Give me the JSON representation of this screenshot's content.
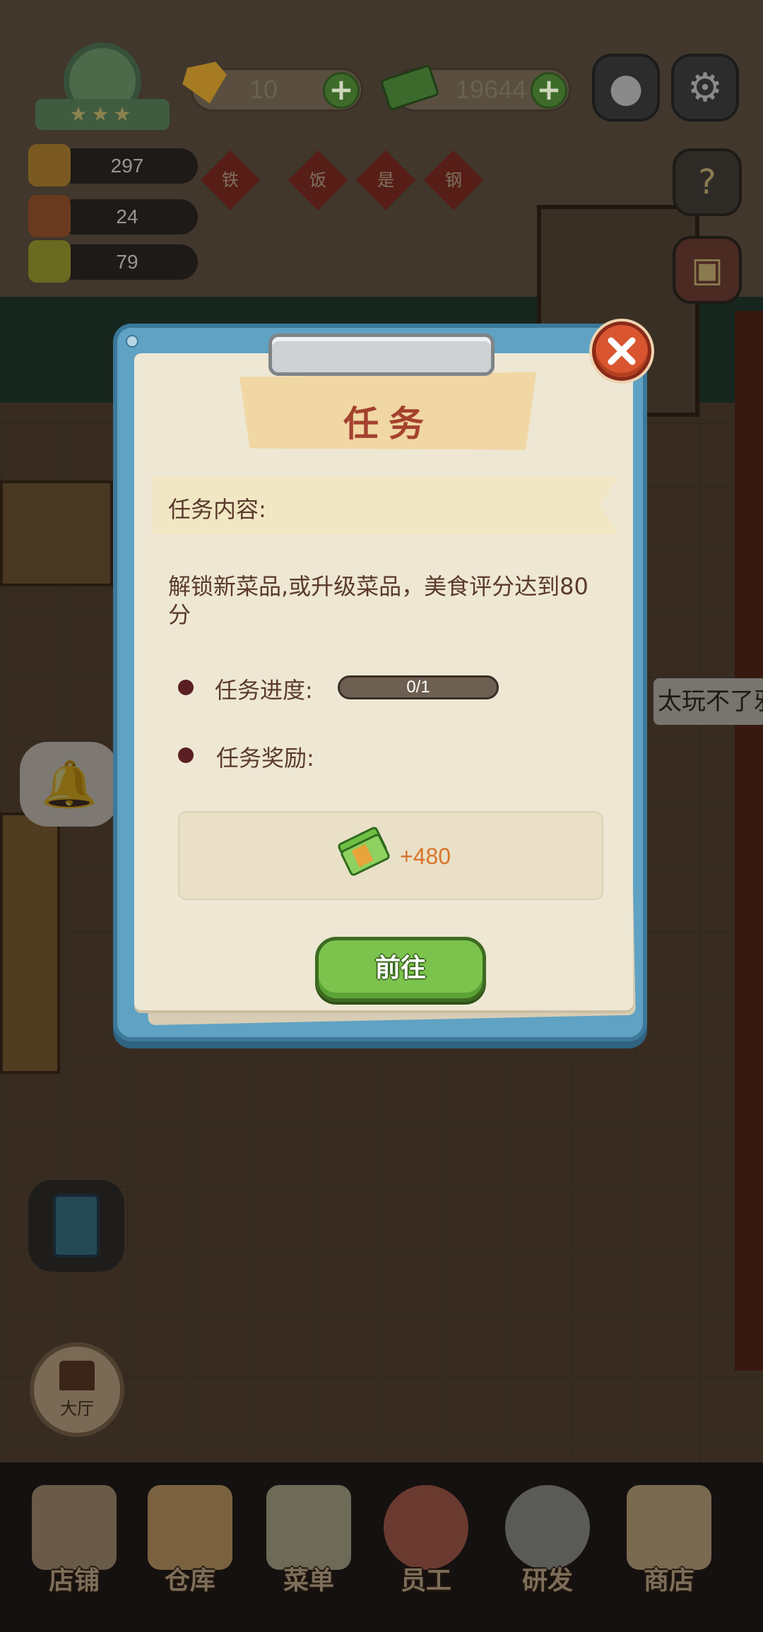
{
  "hud": {
    "gems": "10",
    "cash": "19644",
    "stats": [
      "297",
      "24",
      "79"
    ],
    "wall_sign_chars": [
      "铁",
      "饭",
      "是",
      "钢"
    ],
    "customer_bubble": "太玩不了邪"
  },
  "dialog": {
    "title": "任务",
    "content_label": "任务内容:",
    "description": "解锁新菜品,或升级菜品，美食评分达到80分",
    "progress_label": "任务进度:",
    "progress_text": "0/1",
    "progress_fraction": 0,
    "reward_label": "任务奖励:",
    "reward_amount": "+480",
    "go_button": "前往"
  },
  "side": {
    "hall_label": "大厅"
  },
  "nav": [
    {
      "label": "店铺",
      "icon": "shop-icon"
    },
    {
      "label": "仓库",
      "icon": "warehouse-icon"
    },
    {
      "label": "菜单",
      "icon": "menu-icon"
    },
    {
      "label": "员工",
      "icon": "staff-icon"
    },
    {
      "label": "研发",
      "icon": "wok-icon"
    },
    {
      "label": "商店",
      "icon": "store-icon"
    }
  ],
  "colors": {
    "dialog_frame": "#5fa2c3",
    "title": "#a4412f",
    "reward_amount": "#d9742a",
    "go_button": "#7cc34d",
    "close_button": "#d9552f"
  }
}
